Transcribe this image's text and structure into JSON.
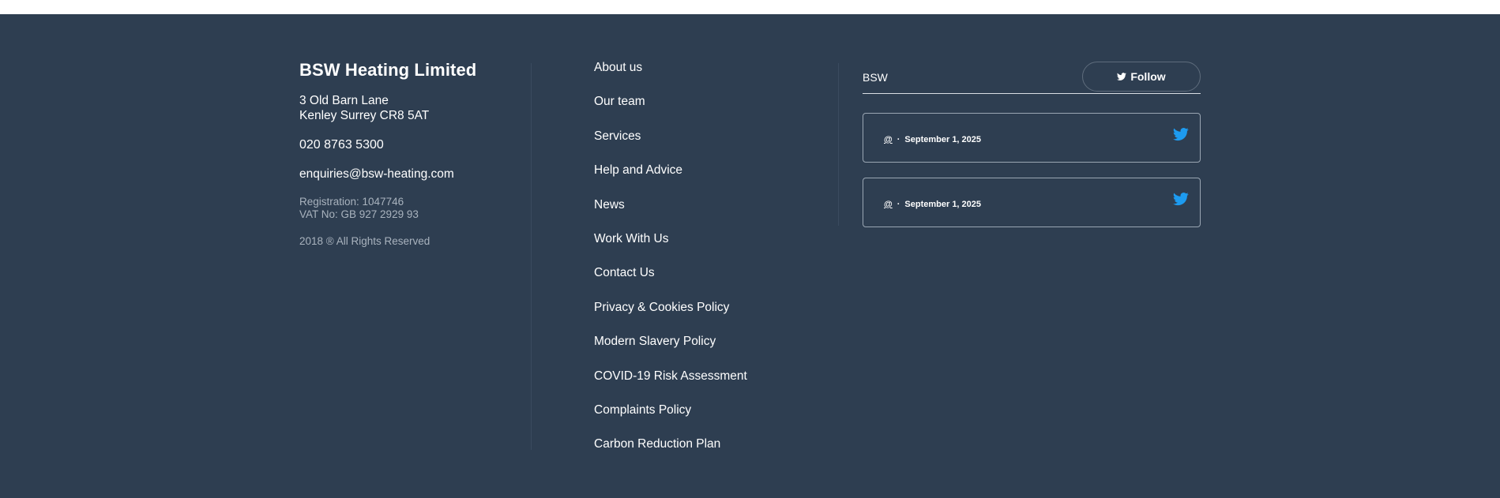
{
  "company": {
    "name": "BSW Heating Limited",
    "address_line1": "3 Old Barn Lane",
    "address_line2": "Kenley Surrey CR8 5AT",
    "phone": "020 8763 5300",
    "email": "enquiries@bsw-heating.com",
    "registration": "Registration: 1047746",
    "vat": "VAT No: GB 927 2929 93",
    "rights": "2018 ® All Rights Reserved"
  },
  "nav": {
    "items": [
      "About us",
      "Our team",
      "Services",
      "Help and Advice",
      "News",
      "Work With Us",
      "Contact Us",
      "Privacy & Cookies Policy",
      "Modern Slavery Policy",
      "COVID-19 Risk Assessment",
      "Complaints Policy",
      "Carbon Reduction Plan"
    ]
  },
  "twitter": {
    "name": "BSW",
    "follow_label": "Follow",
    "tweets": [
      {
        "handle": "@",
        "separator": "·",
        "date": "September 1, 2025"
      },
      {
        "handle": "@",
        "separator": "·",
        "date": "September 1, 2025"
      }
    ]
  },
  "colors": {
    "footer_bg": "#2e3e51",
    "twitter_blue": "#1d9bf0"
  },
  "icons": {
    "tweet": "twitter-bird-icon",
    "follow": "twitter-bird-icon"
  }
}
